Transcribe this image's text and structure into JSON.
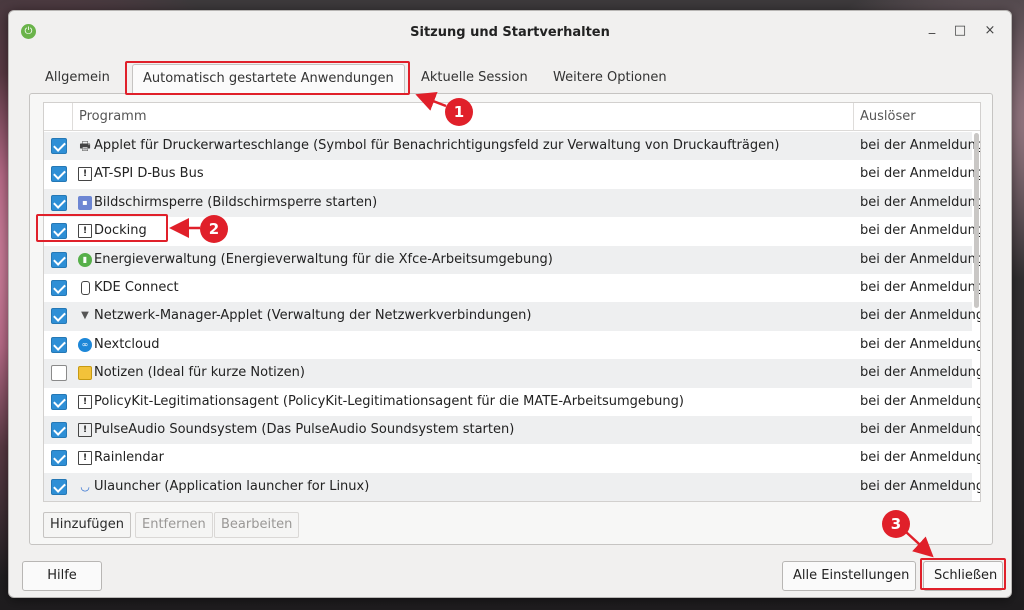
{
  "window": {
    "title": "Sitzung und Startverhalten",
    "controls": {
      "minimize": "_",
      "maximize": "□",
      "close": "×"
    }
  },
  "tabs": [
    "Allgemein",
    "Automatisch gestartete Anwendungen",
    "Aktuelle Session",
    "Weitere Optionen"
  ],
  "active_tab": "Automatisch gestartete Anwendungen",
  "table": {
    "columns": [
      "Programm",
      "Auslöser"
    ],
    "rows": [
      {
        "checked": true,
        "icon": "printer-icon",
        "name": "Applet für Druckerwarteschlange (Symbol für Benachrichtigungsfeld zur Verwaltung von Druckaufträgen)",
        "trigger": "bei der Anmeldung"
      },
      {
        "checked": true,
        "icon": "generic-app-icon",
        "name": "AT-SPI D-Bus Bus",
        "trigger": "bei der Anmeldung"
      },
      {
        "checked": true,
        "icon": "screen-lock-icon",
        "name": "Bildschirmsperre (Bildschirmsperre starten)",
        "trigger": "bei der Anmeldung"
      },
      {
        "checked": true,
        "icon": "generic-app-icon",
        "name": "Docking",
        "trigger": "bei der Anmeldung"
      },
      {
        "checked": true,
        "icon": "battery-icon",
        "name": "Energieverwaltung (Energieverwaltung für die Xfce-Arbeitsumgebung)",
        "trigger": "bei der Anmeldung"
      },
      {
        "checked": true,
        "icon": "phone-icon",
        "name": "KDE Connect",
        "trigger": "bei der Anmeldung"
      },
      {
        "checked": true,
        "icon": "wifi-icon",
        "name": "Netzwerk-Manager-Applet (Verwaltung der Netzwerkverbindungen)",
        "trigger": "bei der Anmeldung"
      },
      {
        "checked": true,
        "icon": "nextcloud-icon",
        "name": "Nextcloud",
        "trigger": "bei der Anmeldung"
      },
      {
        "checked": false,
        "icon": "notes-icon",
        "name": "Notizen (Ideal für kurze Notizen)",
        "trigger": "bei der Anmeldung"
      },
      {
        "checked": true,
        "icon": "generic-app-icon",
        "name": "PolicyKit-Legitimationsagent (PolicyKit-Legitimationsagent für die MATE-Arbeitsumgebung)",
        "trigger": "bei der Anmeldung"
      },
      {
        "checked": true,
        "icon": "generic-app-icon",
        "name": "PulseAudio Soundsystem (Das PulseAudio Soundsystem starten)",
        "trigger": "bei der Anmeldung"
      },
      {
        "checked": true,
        "icon": "generic-app-icon",
        "name": "Rainlendar",
        "trigger": "bei der Anmeldung"
      },
      {
        "checked": true,
        "icon": "ulauncher-icon",
        "name": "Ulauncher (Application launcher for Linux)",
        "trigger": "bei der Anmeldung"
      }
    ]
  },
  "panel_buttons": {
    "add": "Hinzufügen",
    "remove": "Entfernen",
    "edit": "Bearbeiten"
  },
  "footer": {
    "help": "Hilfe",
    "all_settings": "Alle Einstellungen",
    "close": "Schließen"
  },
  "annotations": {
    "badge1": "1",
    "badge2": "2",
    "badge3": "3",
    "color": "#e0202a"
  }
}
